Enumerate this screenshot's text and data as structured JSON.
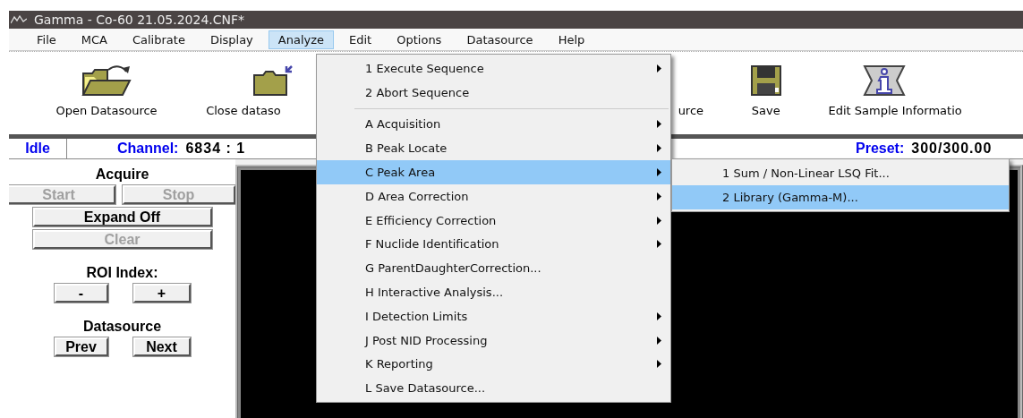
{
  "window": {
    "title": "Gamma - Co-60 21.05.2024.CNF*"
  },
  "menu_bar": [
    {
      "label": "File",
      "selected": false
    },
    {
      "label": "MCA",
      "selected": false
    },
    {
      "label": "Calibrate",
      "selected": false
    },
    {
      "label": "Display",
      "selected": false
    },
    {
      "label": "Analyze",
      "selected": true
    },
    {
      "label": "Edit",
      "selected": false
    },
    {
      "label": "Options",
      "selected": false
    },
    {
      "label": "Datasource",
      "selected": false
    },
    {
      "label": "Help",
      "selected": false
    }
  ],
  "toolbar": [
    {
      "label": "Open Datasource",
      "kind": "open"
    },
    {
      "label": "Close dataso",
      "kind": "close"
    },
    {
      "label": "urce",
      "kind": "hidden"
    },
    {
      "label": "Save",
      "kind": "save"
    },
    {
      "label": "Edit Sample Informatio",
      "kind": "info"
    }
  ],
  "status_bar": {
    "state": "Idle",
    "channel_label": "Channel:",
    "channel_value": "6834 : 1",
    "preset_label": "Preset:",
    "preset_value": "300/300.00"
  },
  "control_panel": [
    {
      "kind": "heading",
      "label": "Acquire"
    },
    {
      "kind": "widepair",
      "buttons": [
        {
          "label": "Start",
          "disabled": true
        },
        {
          "label": "Stop",
          "disabled": true
        }
      ]
    },
    {
      "kind": "single",
      "buttons": [
        {
          "label": "Expand Off",
          "disabled": false
        }
      ]
    },
    {
      "kind": "single",
      "buttons": [
        {
          "label": "Clear",
          "disabled": true
        }
      ]
    },
    {
      "kind": "heading",
      "label": "ROI Index:"
    },
    {
      "kind": "pair",
      "buttons": [
        {
          "label": "-",
          "disabled": false
        },
        {
          "label": "+",
          "disabled": false
        }
      ]
    },
    {
      "kind": "heading",
      "label": "Datasource"
    },
    {
      "kind": "pair",
      "buttons": [
        {
          "label": "Prev",
          "disabled": false
        },
        {
          "label": "Next",
          "disabled": false
        }
      ]
    }
  ],
  "analyze_menu": [
    {
      "kind": "item",
      "label": "1 Execute Sequence",
      "submenu": true,
      "selected": false
    },
    {
      "kind": "item",
      "label": "2 Abort Sequence",
      "submenu": false,
      "selected": false
    },
    {
      "kind": "separator"
    },
    {
      "kind": "item",
      "label": "A Acquisition",
      "submenu": true,
      "selected": false
    },
    {
      "kind": "item",
      "label": "B Peak Locate",
      "submenu": true,
      "selected": false
    },
    {
      "kind": "item",
      "label": "C Peak Area",
      "submenu": true,
      "selected": true
    },
    {
      "kind": "item",
      "label": "D Area Correction",
      "submenu": true,
      "selected": false
    },
    {
      "kind": "item",
      "label": "E Efficiency Correction",
      "submenu": true,
      "selected": false
    },
    {
      "kind": "item",
      "label": "F Nuclide Identification",
      "submenu": true,
      "selected": false
    },
    {
      "kind": "item",
      "label": "G ParentDaughterCorrection...",
      "submenu": false,
      "selected": false
    },
    {
      "kind": "item",
      "label": "H Interactive Analysis...",
      "submenu": false,
      "selected": false
    },
    {
      "kind": "item",
      "label": "I Detection Limits",
      "submenu": true,
      "selected": false
    },
    {
      "kind": "item",
      "label": "J Post NID Processing",
      "submenu": true,
      "selected": false
    },
    {
      "kind": "item",
      "label": "K Reporting",
      "submenu": true,
      "selected": false
    },
    {
      "kind": "item",
      "label": "L Save Datasource...",
      "submenu": false,
      "selected": false
    }
  ],
  "peak_area_submenu": [
    {
      "label": "1 Sum / Non-Linear LSQ Fit...",
      "selected": false
    },
    {
      "label": "2 Library (Gamma-M)...",
      "selected": true
    }
  ]
}
